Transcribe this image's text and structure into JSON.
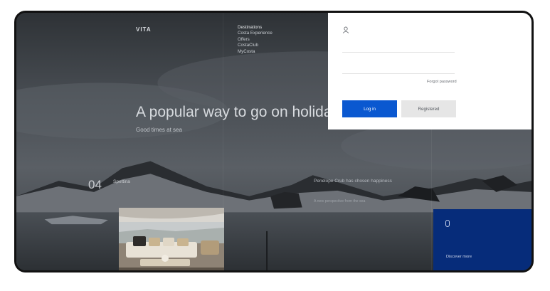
{
  "brand": {
    "name": "VITA"
  },
  "nav": {
    "items": [
      "Destinations",
      "Costa Experience",
      "Offers",
      "CostaClub",
      "MyCosta"
    ]
  },
  "hero": {
    "headline": "A popular way to go on holida",
    "subline": "Good times at sea"
  },
  "feature": {
    "number": "04",
    "label": "Spettina"
  },
  "promo": {
    "title": "Penelope Crub has chosen happiness",
    "subtitle": "A new perspective from the sea"
  },
  "blue_card": {
    "icon": "map-pin-icon",
    "link": "Discover more"
  },
  "login": {
    "user_icon": "user-icon",
    "username_value": "",
    "password_value": "",
    "forgot_label": "Forgot password",
    "login_label": "Log in",
    "register_label": "Registered"
  },
  "colors": {
    "login_blue": "#0a58d0",
    "card_blue": "#062c7a",
    "overlay": "#3b3f44"
  }
}
